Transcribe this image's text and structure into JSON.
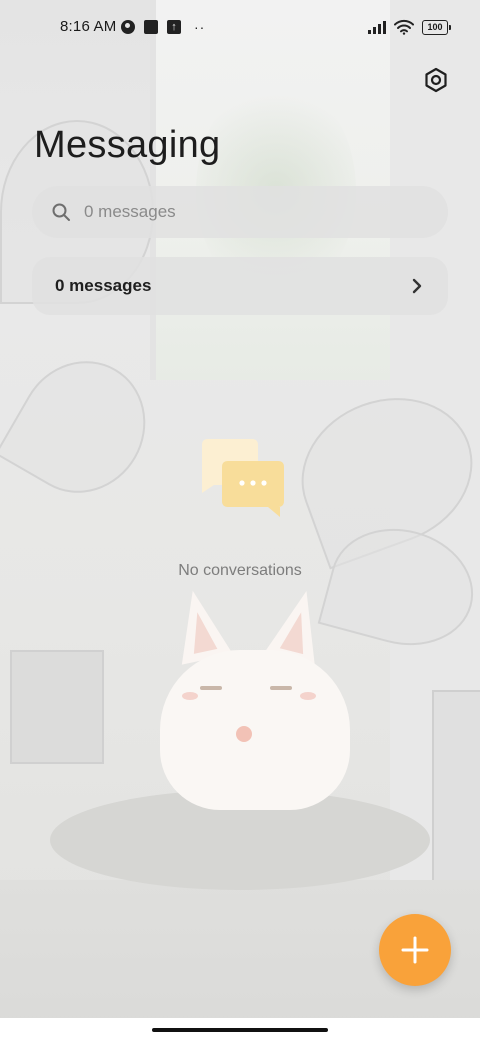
{
  "status_bar": {
    "time": "8:16 AM",
    "battery": "100",
    "notification_icons": [
      "vpn-icon",
      "square-notification-icon",
      "upload-notification-icon"
    ],
    "more_dots": "··"
  },
  "header": {
    "title": "Messaging",
    "settings_icon": "gear-icon"
  },
  "search": {
    "placeholder": "0 messages",
    "value": ""
  },
  "messages_row": {
    "label": "0 messages"
  },
  "empty_state": {
    "text": "No conversations"
  },
  "fab": {
    "icon": "plus-icon"
  },
  "colors": {
    "accent": "#f9a23a",
    "illustration_back": "#fcefd2",
    "illustration_front": "#f8dd9a"
  }
}
